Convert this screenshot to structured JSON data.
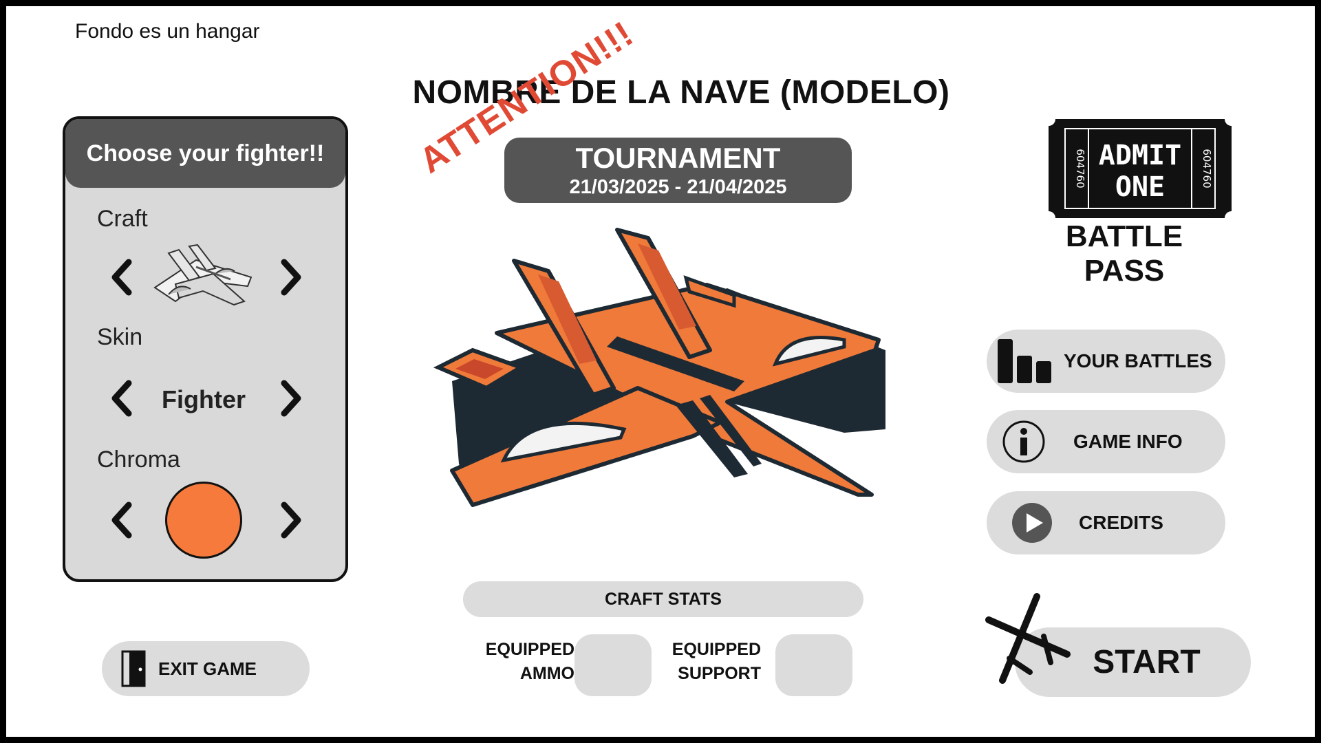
{
  "note": "Fondo es un hangar",
  "ship_title": "NOMBRE DE LA NAVE (MODELO)",
  "fighter_panel": {
    "header": "Choose your fighter!!",
    "craft_label": "Craft",
    "skin_label": "Skin",
    "skin_value": "Fighter",
    "chroma_label": "Chroma",
    "chroma_color": "#f57a3c"
  },
  "tournament": {
    "title": "TOURNAMENT",
    "dates": "21/03/2025 - 21/04/2025",
    "attention": "ATTENTION!!!"
  },
  "battle_pass": {
    "ticket_line1": "ADMIT",
    "ticket_line2": "ONE",
    "ticket_serial": "604760",
    "label": "BATTLE PASS"
  },
  "menu": {
    "your_battles": "YOUR BATTLES",
    "game_info": "GAME INFO",
    "credits": "CREDITS"
  },
  "stats": {
    "title": "CRAFT STATS",
    "ammo_line1": "EQUIPPED",
    "ammo_line2": "AMMO",
    "support_line1": "EQUIPPED",
    "support_line2": "SUPPORT"
  },
  "exit_label": "EXIT GAME",
  "start_label": "START",
  "colors": {
    "ship_orange": "#f07a3a",
    "ship_dark": "#1e2a33",
    "panel_gray": "#d9d9d9",
    "header_gray": "#555555",
    "attention_red": "#e04a35"
  },
  "icons": {
    "arrows": "chevron-left / chevron-right",
    "battles": "bar-chart-icon",
    "info": "info-icon",
    "credits": "play-icon",
    "exit": "door-icon",
    "start": "crossed-swords-icon",
    "battle_pass": "ticket-icon"
  }
}
